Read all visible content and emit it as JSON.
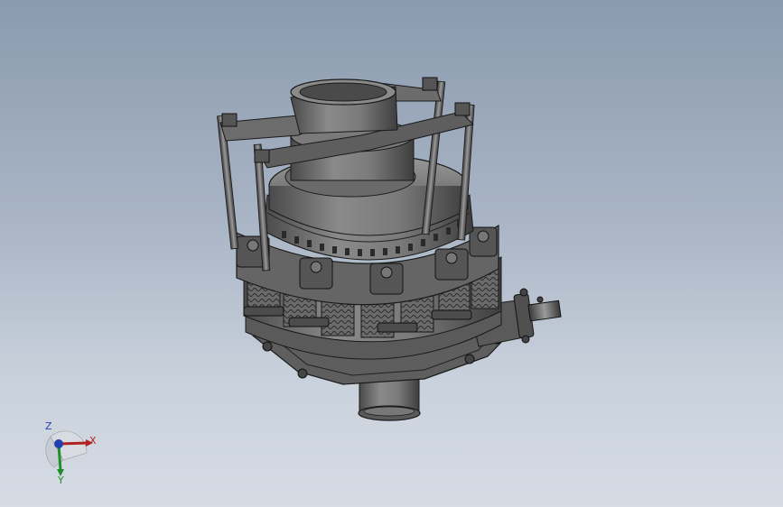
{
  "viewport": {
    "background_top": "#8b9aaf",
    "background_bottom": "#d6dce4",
    "model_shade": "#6e6e6e",
    "edge_color": "#1a1a1a"
  },
  "triad": {
    "x_label": "X",
    "y_label": "Y",
    "z_label": "Z",
    "x_color": "#b22222",
    "y_color": "#1f8f2a",
    "z_color": "#2340b0"
  }
}
